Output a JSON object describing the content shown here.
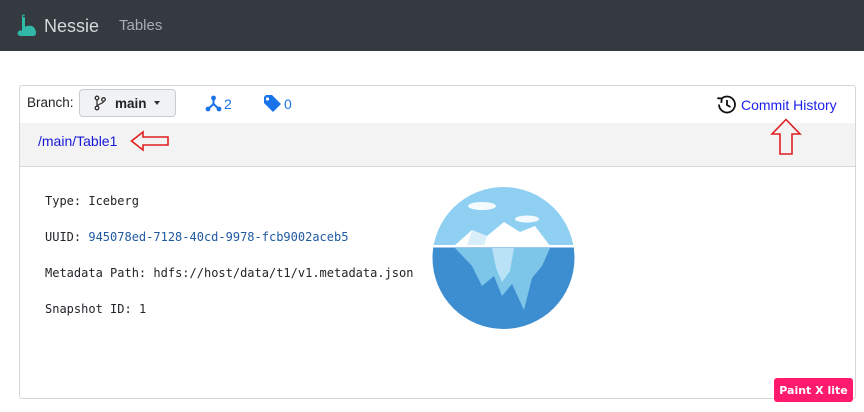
{
  "navbar": {
    "brand_name": "Nessie",
    "links": [
      "Tables"
    ]
  },
  "toolbar": {
    "branch_label": "Branch:",
    "branch_selected": "main",
    "branches_count": "2",
    "tags_count": "0",
    "commit_history_label": "Commit History"
  },
  "breadcrumb": "/main/Table1",
  "details": {
    "type_label": "Type:",
    "type_value": "Iceberg",
    "uuid_label": "UUID:",
    "uuid_value": "945078ed-7128-40cd-9978-fcb9002aceb5",
    "metadata_label": "Metadata Path:",
    "metadata_value": "hdfs://host/data/t1/v1.metadata.json",
    "snapshot_label": "Snapshot ID:",
    "snapshot_value": "1"
  },
  "watermark": "Paint X lite",
  "icons": {
    "logo": "nessie-dinosaur-icon",
    "branch": "git-branch-icon",
    "branches": "git-fork-icon",
    "tags": "tag-icon",
    "history": "history-clock-icon",
    "table_type": "iceberg-icon"
  },
  "colors": {
    "navbar_bg": "#343a40",
    "link": "#1a73e8",
    "annotation_arrow": "#e02020",
    "watermark_bg": "#ff1a6d"
  }
}
